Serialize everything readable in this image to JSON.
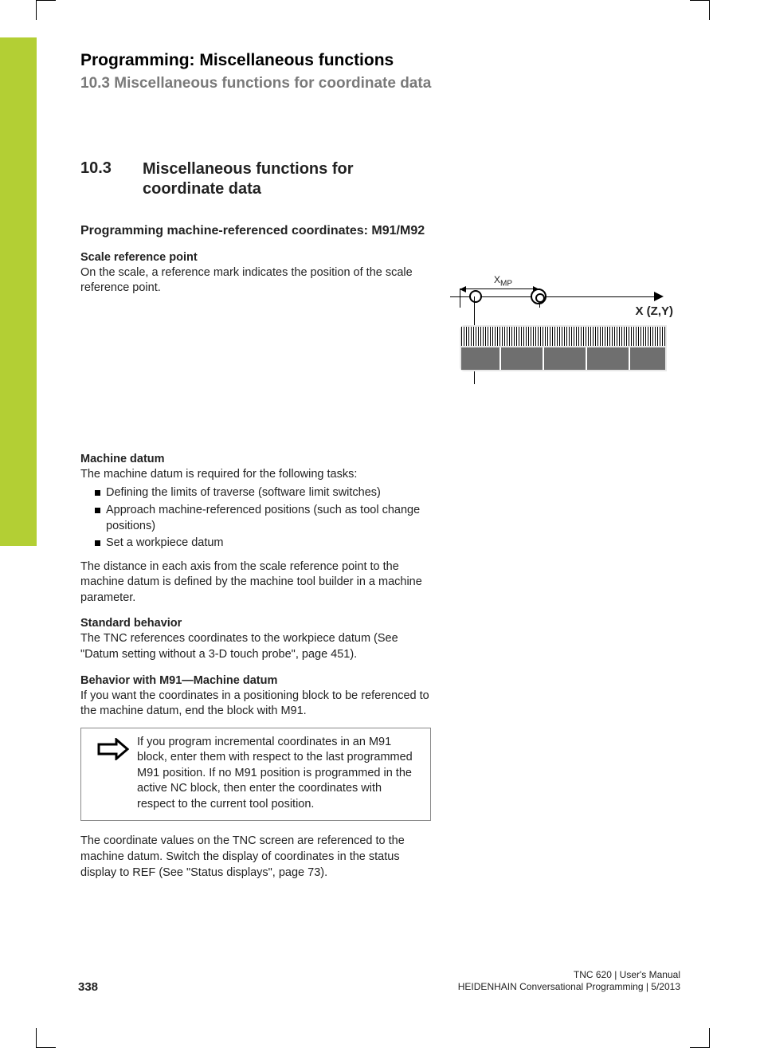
{
  "header": {
    "chapter_number": "10",
    "chapter_title": "Programming: Miscellaneous functions",
    "section_line": "10.3   Miscellaneous functions for coordinate data"
  },
  "section": {
    "number": "10.3",
    "title": "Miscellaneous functions for coordinate data"
  },
  "h1": "Programming machine-referenced coordinates: M91/M92",
  "scale_ref": {
    "heading": "Scale reference point",
    "text": "On the scale, a reference mark indicates the position of the scale reference point."
  },
  "machine_datum": {
    "heading": "Machine datum",
    "intro": "The machine datum is required for the following tasks:",
    "bullets": [
      "Defining the limits of traverse (software limit switches)",
      "Approach machine-referenced positions (such as tool change positions)",
      "Set a workpiece datum"
    ],
    "para_after": "The distance in each axis from the scale reference point to the machine datum is defined by the machine tool builder in a machine parameter."
  },
  "standard": {
    "heading": "Standard behavior",
    "text": "The TNC references coordinates to the workpiece datum (See \"Datum setting without a 3-D touch probe\", page 451)."
  },
  "m91": {
    "heading": "Behavior with M91—Machine datum",
    "text": "If you want the coordinates in a positioning block to be referenced to the machine datum, end the block with M91."
  },
  "note": "If you program incremental coordinates in an M91 block, enter them with respect to the last programmed M91 position. If no M91 position is programmed in the active NC block, then enter the coordinates with respect to the current tool position.",
  "after_note": "The coordinate values on the TNC screen are referenced to the machine datum. Switch the display of coordinates in the status display to REF (See \"Status displays\", page 73).",
  "diagram": {
    "xmp": "X",
    "xmp_sub": "MP",
    "axis_label": "X (Z,Y)"
  },
  "footer": {
    "page": "338",
    "line1": "TNC 620 | User's Manual",
    "line2": "HEIDENHAIN Conversational Programming | 5/2013"
  }
}
